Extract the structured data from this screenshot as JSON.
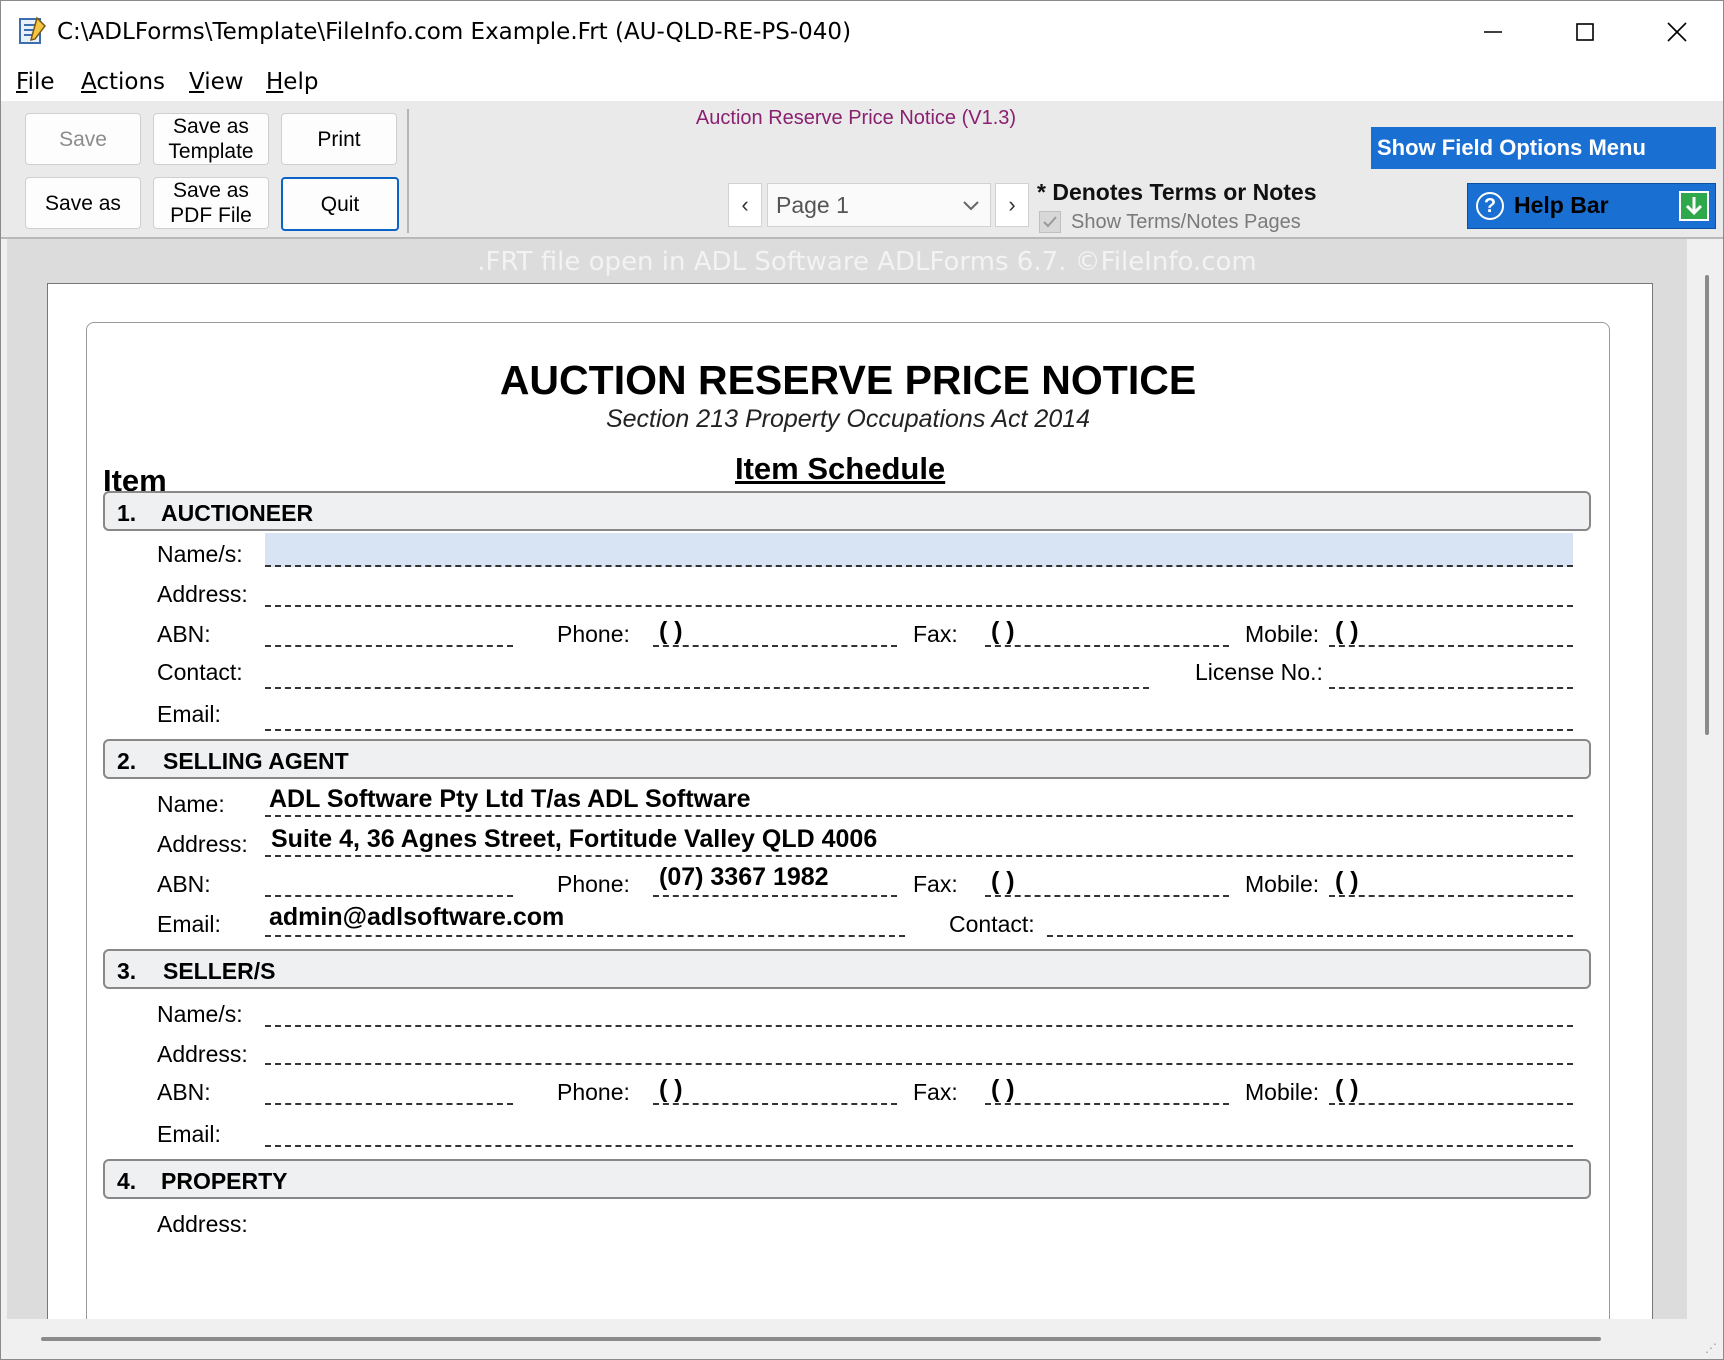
{
  "window": {
    "title": "C:\\ADLForms\\Template\\FileInfo.com Example.Frt (AU-QLD-RE-PS-040)"
  },
  "menu": {
    "file": {
      "u": "F",
      "rest": "ile"
    },
    "actions": {
      "u": "A",
      "rest": "ctions"
    },
    "view": {
      "u": "V",
      "rest": "iew"
    },
    "help": {
      "u": "H",
      "rest": "elp"
    }
  },
  "toolbar": {
    "save": "Save",
    "save_as_template_l1": "Save as",
    "save_as_template_l2": "Template",
    "print": "Print",
    "save_as": "Save as",
    "save_as_pdf_l1": "Save as",
    "save_as_pdf_l2": "PDF File",
    "quit": "Quit",
    "form_title": "Auction Reserve Price Notice (V1.3)",
    "page_select": "Page 1",
    "prev": "‹",
    "next": "›",
    "denotes": "* Denotes Terms or Notes",
    "show_terms": "Show Terms/Notes Pages",
    "field_options": "Show Field Options Menu",
    "help_bar": "Help Bar",
    "help_q": "?"
  },
  "watermark": ".FRT file open in ADL Software ADLForms 6.7. ©FileInfo.com",
  "document": {
    "title": "AUCTION RESERVE PRICE NOTICE",
    "subtitle": "Section 213 Property Occupations Act 2014",
    "item_label": "Item",
    "item_schedule": "Item Schedule",
    "sections": [
      {
        "num": "1.",
        "title": "AUCTIONEER"
      },
      {
        "num": "2.",
        "title": "SELLING AGENT"
      },
      {
        "num": "3.",
        "title": "SELLER/S"
      },
      {
        "num": "4.",
        "title": "PROPERTY"
      }
    ],
    "labels": {
      "names": "Name/s:",
      "name": "Name:",
      "address": "Address:",
      "abn": "ABN:",
      "phone": "Phone:",
      "fax": "Fax:",
      "mobile": "Mobile:",
      "contact": "Contact:",
      "license": "License No.:",
      "email": "Email:"
    },
    "paren": "(  )",
    "agent": {
      "name": "ADL Software Pty Ltd T/as ADL Software",
      "address": "Suite 4, 36 Agnes Street, Fortitude Valley QLD 4006",
      "phone": "(07) 3367 1982",
      "email": "admin@adlsoftware.com"
    }
  },
  "colors": {
    "accent": "#1a6fd3",
    "form_title": "#8a2070",
    "active_field": "#d8e4f4",
    "help_arrow": "#2ea84a"
  }
}
